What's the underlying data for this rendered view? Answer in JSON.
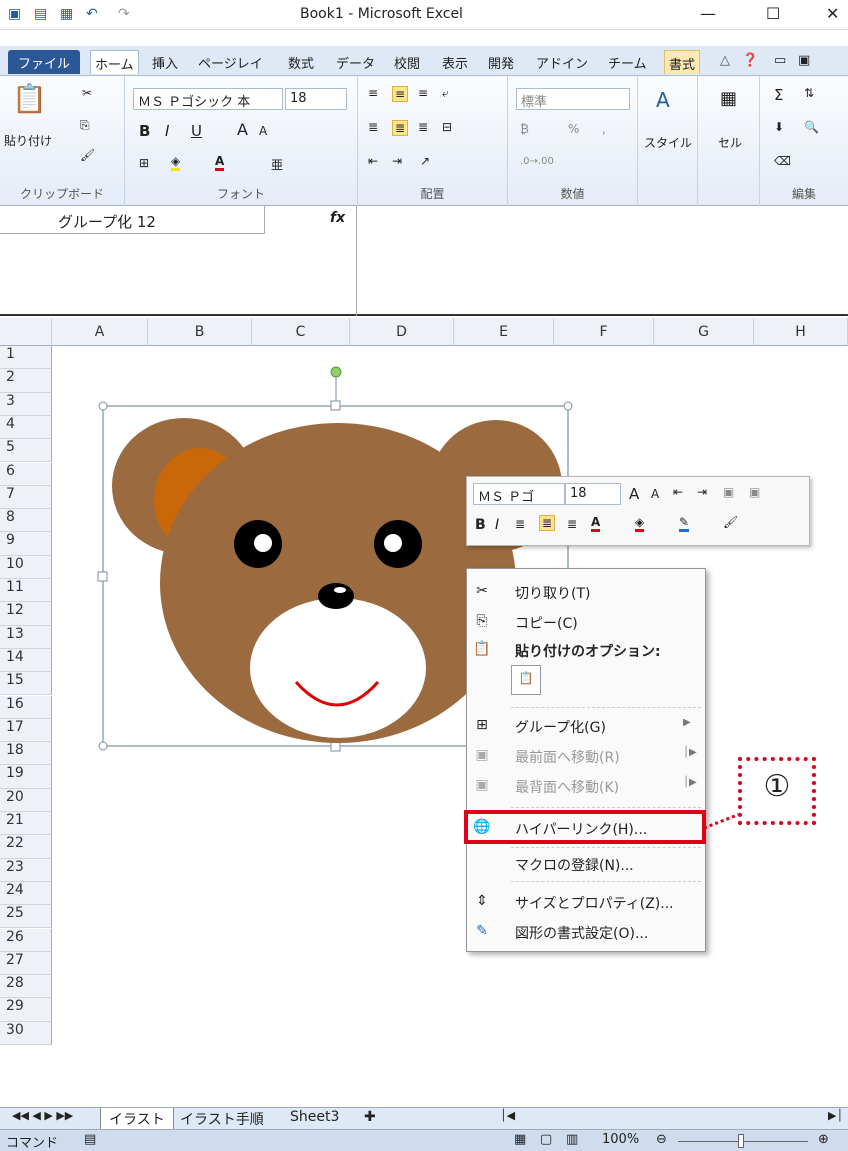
{
  "window": {
    "title": "Book1 - Microsoft Excel",
    "buttons": [
      "—",
      "☐",
      "✕"
    ]
  },
  "tabs": [
    "ファイル",
    "ホーム",
    "挿入",
    "ページレイ",
    "数式",
    "データ",
    "校閲",
    "表示",
    "開発",
    "アドイン",
    "チーム",
    "書式"
  ],
  "ribbon": {
    "clipboard": {
      "label": "クリップボード",
      "paste": "貼り付け"
    },
    "font": {
      "label": "フォント",
      "name": "ＭＳ Ｐゴシック 本",
      "size": "18"
    },
    "align": {
      "label": "配置"
    },
    "number": {
      "label": "数値",
      "format": "標準"
    },
    "styles": {
      "label": "スタイル"
    },
    "cells": {
      "label": "セル"
    },
    "edit": {
      "label": "編集"
    }
  },
  "formula_bar": {
    "name_box": "グループ化 12",
    "fx": "fx"
  },
  "columns": [
    "A",
    "B",
    "C",
    "D",
    "E",
    "F",
    "G",
    "H"
  ],
  "rows": [
    "1",
    "2",
    "3",
    "4",
    "5",
    "6",
    "7",
    "8",
    "9",
    "10",
    "11",
    "12",
    "13",
    "14",
    "15",
    "16",
    "17",
    "18",
    "19",
    "20",
    "21",
    "22",
    "23",
    "24",
    "25",
    "26",
    "27",
    "28",
    "29",
    "30"
  ],
  "mini_toolbar": {
    "font": "ＭＳ Ｐゴ",
    "size": "18"
  },
  "context_menu": {
    "items": [
      {
        "label": "切り取り(T)",
        "icon": "cut-icon",
        "enabled": true
      },
      {
        "label": "コピー(C)",
        "icon": "copy-icon",
        "enabled": true
      },
      {
        "label": "貼り付けのオプション:",
        "icon": "paste-icon",
        "enabled": true
      },
      {
        "label": "グループ化(G)",
        "icon": "group-icon",
        "enabled": true,
        "submenu": true
      },
      {
        "label": "最前面へ移動(R)",
        "icon": "bring-front-icon",
        "enabled": false,
        "submenu": true
      },
      {
        "label": "最背面へ移動(K)",
        "icon": "send-back-icon",
        "enabled": false,
        "submenu": true
      },
      {
        "label": "ハイパーリンク(H)...",
        "icon": "hyperlink-icon",
        "enabled": true
      },
      {
        "label": "マクロの登録(N)...",
        "icon": "",
        "enabled": true
      },
      {
        "label": "サイズとプロパティ(Z)...",
        "icon": "size-icon",
        "enabled": true
      },
      {
        "label": "図形の書式設定(O)...",
        "icon": "format-shape-icon",
        "enabled": true
      }
    ]
  },
  "callout": {
    "label": "①"
  },
  "sheet_tabs": [
    "イラスト",
    "イラスト手順",
    "Sheet3"
  ],
  "status": {
    "mode": "コマンド",
    "zoom": "100%"
  },
  "colors": {
    "bear_brown": "#9b6a3e",
    "ear_inner": "#c8680a",
    "highlight": "#e0001a"
  }
}
